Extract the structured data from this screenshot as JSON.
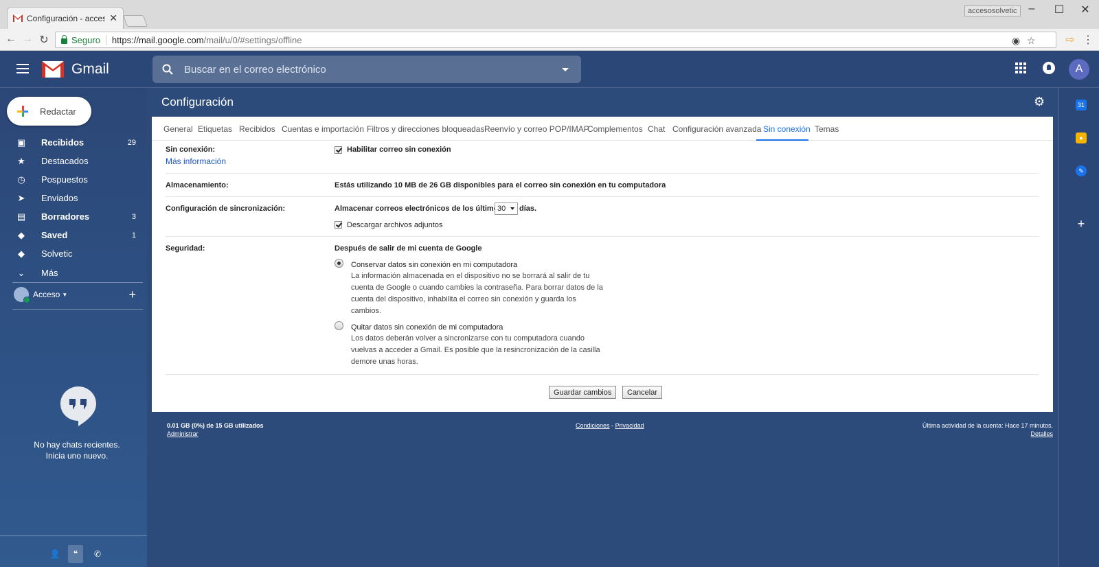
{
  "browser": {
    "tab_title": "Configuración - accesos",
    "profile": "accesosolvetic",
    "secure_label": "Seguro",
    "url_host": "https://mail.google.com",
    "url_path": "/mail/u/0/#settings/offline"
  },
  "gmail": {
    "brand": "Gmail",
    "search_placeholder": "Buscar en el correo electrónico",
    "avatar_letter": "A",
    "compose_label": "Redactar",
    "nav": [
      {
        "label": "Recibidos",
        "count": "29",
        "icon": "inbox-icon"
      },
      {
        "label": "Destacados",
        "count": "",
        "icon": "star-icon"
      },
      {
        "label": "Pospuestos",
        "count": "",
        "icon": "clock-icon"
      },
      {
        "label": "Enviados",
        "count": "",
        "icon": "send-icon"
      },
      {
        "label": "Borradores",
        "count": "3",
        "icon": "draft-icon"
      },
      {
        "label": "Saved",
        "count": "1",
        "icon": "label-icon"
      },
      {
        "label": "Solvetic",
        "count": "",
        "icon": "label-icon"
      },
      {
        "label": "Más",
        "count": "",
        "icon": "chevron-down-icon"
      }
    ],
    "account_name": "Acceso",
    "no_chats": "No hay chats recientes.",
    "start_chat": "Inicia uno nuevo."
  },
  "settings": {
    "title": "Configuración",
    "tabs": [
      "General",
      "Etiquetas",
      "Recibidos",
      "Cuentas e importación",
      "Filtros y direcciones bloqueadas",
      "Reenvío y correo POP/IMAP",
      "Complementos",
      "Chat",
      "Configuración avanzada",
      "Sin conexión",
      "Temas"
    ],
    "offline_label": "Sin conexión:",
    "more_info": "Más información",
    "enable_offline": "Habilitar correo sin conexión",
    "storage_label": "Almacenamiento:",
    "storage_text": "Estás utilizando 10 MB de 26 GB disponibles para el correo sin conexión en tu computadora",
    "sync_label": "Configuración de sincronización:",
    "sync_prefix": "Almacenar correos electrónicos de los últimos",
    "sync_days": "30",
    "sync_suffix": "días.",
    "download_attachments": "Descargar archivos adjuntos",
    "security_label": "Seguridad:",
    "security_heading": "Después de salir de mi cuenta de Google",
    "keep_option": "Conservar datos sin conexión en mi computadora",
    "keep_desc": "La información almacenada en el dispositivo no se borrará al salir de tu cuenta de Google o cuando cambies la contraseña. Para borrar datos de la cuenta del dispositivo, inhabilita el correo sin conexión y guarda los cambios.",
    "remove_option": "Quitar datos sin conexión de mi computadora",
    "remove_desc": "Los datos deberán volver a sincronizarse con tu computadora cuando vuelvas a acceder a Gmail. Es posible que la resincronización de la casilla demore unas horas.",
    "save_button": "Guardar cambios",
    "cancel_button": "Cancelar"
  },
  "footer": {
    "usage": "0.01 GB (0%) de 15 GB utilizados",
    "manage": "Administrar",
    "terms": "Condiciones",
    "dash": "-",
    "privacy": "Privacidad",
    "last_activity": "Última actividad de la cuenta: Hace 17 minutos.",
    "details": "Detalles"
  }
}
